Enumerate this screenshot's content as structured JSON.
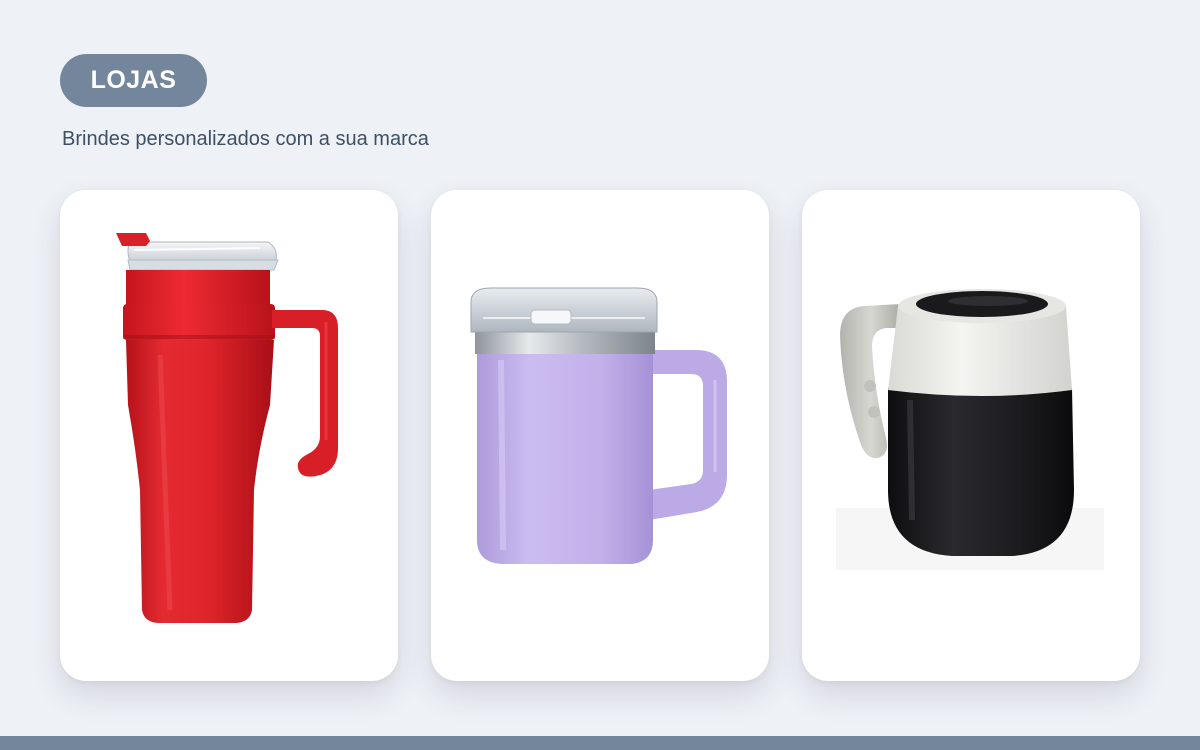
{
  "header": {
    "badge_label": "LOJAS",
    "subtitle": "Brindes personalizados com a sua marca"
  },
  "products": [
    {
      "image": "red-tumbler-with-handle",
      "color": "#e0242b"
    },
    {
      "image": "lavender-mug-with-clear-lid",
      "color": "#c4b3ea"
    },
    {
      "image": "black-white-thermal-mug",
      "color": "#1c1c1e"
    }
  ],
  "colors": {
    "background": "#eef1f6",
    "accent": "#73869c",
    "subtitle_text": "#3e4f63",
    "card": "#ffffff"
  }
}
